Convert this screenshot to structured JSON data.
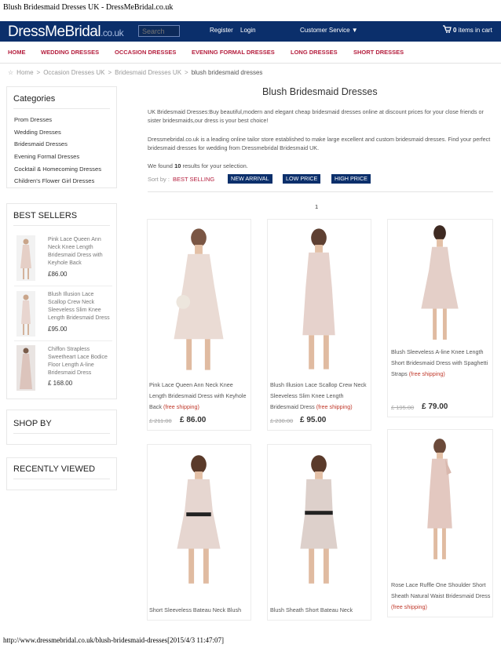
{
  "page_title": "Blush Bridesmaid Dresses UK - DressMeBridal.co.uk",
  "footer_url": "http://www.dressmebridal.co.uk/blush-bridesmaid-dresses[2015/4/3 11:47:07]",
  "header": {
    "logo_main": "DressMeBridal",
    "logo_domain": ".co.uk",
    "search_placeholder": "Search",
    "register": "Register",
    "login": "Login",
    "customer_service": "Customer Service ▼",
    "cart_count": "0",
    "cart_label": "items in cart"
  },
  "nav": [
    "HOME",
    "WEDDING DRESSES",
    "OCCASION DRESSES",
    "EVENING FORMAL DRESSES",
    "LONG DRESSES",
    "SHORT DRESSES"
  ],
  "breadcrumb": {
    "home": "Home",
    "sep": ">",
    "item1": "Occasion Dresses UK",
    "item2": "Bridesmaid Dresses UK",
    "current": "blush bridesmaid dresses"
  },
  "sidebar": {
    "categories_title": "Categories",
    "categories": [
      "Prom Dresses",
      "Wedding Dresses",
      "Bridesmaid Dresses",
      "Evening Formal Dresses",
      "Cocktail & Homecoming Dresses",
      "Children's Flower Girl Dresses"
    ],
    "best_sellers_title": "BEST SELLERS",
    "best_sellers": [
      {
        "name": "Pink Lace Queen Ann Neck Knee Length Bridesmaid Dress with Keyhole Back",
        "price": "£86.00"
      },
      {
        "name": "Blush Illusion Lace Scallop Crew Neck Sleeveless Slim Knee Length Bridesmaid Dress",
        "price": "£95.00"
      },
      {
        "name": "Chiffon Strapless Sweetheart Lace Bodice Floor Length A-line Bridesmaid Dress",
        "price": "£ 168.00"
      }
    ],
    "shop_by_title": "SHOP BY",
    "recently_viewed_title": "RECENTLY VIEWED"
  },
  "main": {
    "heading": "Blush Bridesmaid Dresses",
    "desc1": "UK Bridesmaid Dresses:Buy beautiful,modern and elegant cheap bridesmaid dresses online at discount prices for your close friends or sister bridesmaids,our dress is your best choice!",
    "desc2": "Dressmebridal.co.uk is a leading online tailor store established to make large excellent and custom bridesmaid dresses. Find your perfect bridesmaid dresses for wedding from Dressmebridal Bridesmaid UK.",
    "found_prefix": "We found",
    "found_count": "10",
    "found_suffix": "results for your selection.",
    "sort_label": "Sort by :",
    "sort_best": "BEST SELLING",
    "sort_options": [
      "NEW ARRIVAL",
      "LOW PRICE",
      "HIGH PRICE"
    ],
    "page": "1",
    "products": [
      {
        "name": "Pink Lace Queen Ann Neck Knee Length Bridesmaid Dress with Keyhole Back",
        "free": "(free shipping)",
        "old": "£ 211.00",
        "price": "£ 86.00"
      },
      {
        "name": "Blush Illusion Lace Scallop Crew Neck Sleeveless Slim Knee Length Bridesmaid Dress",
        "free": "(free shipping)",
        "old": "£ 230.00",
        "price": "£ 95.00"
      },
      {
        "name": "Blush Sleeveless A-line Knee Length Short Bridesmaid Dress with Spaghetti Straps",
        "free": "(free shipping)",
        "old": "£ 195.00",
        "price": "£ 79.00"
      },
      {
        "name": "Short Sleeveless Bateau Neck Blush",
        "free": "",
        "old": "",
        "price": ""
      },
      {
        "name": "Blush Sheath Short Bateau Neck",
        "free": "",
        "old": "",
        "price": ""
      },
      {
        "name": "Rose Lace Ruffle One Shoulder Short Sheath Natural Waist Bridesmaid Dress",
        "free": "(free shipping)",
        "old": "",
        "price": ""
      }
    ]
  }
}
